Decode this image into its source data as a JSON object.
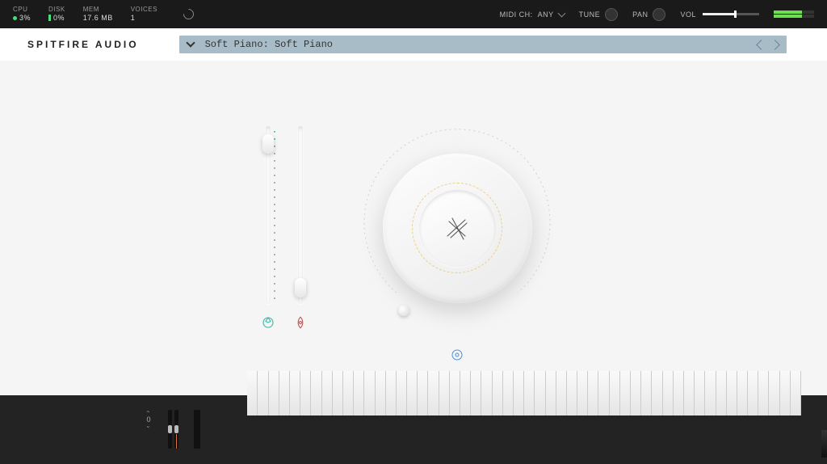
{
  "top": {
    "cpu_label": "CPU",
    "cpu_value": "3%",
    "disk_label": "DISK",
    "disk_value": "0%",
    "mem_label": "MEM",
    "mem_value": "17.6 MB",
    "voices_label": "VOICES",
    "voices_value": "1",
    "midi_label": "MIDI CH:",
    "midi_value": "ANY",
    "tune_label": "TUNE",
    "pan_label": "PAN",
    "vol_label": "VOL"
  },
  "brand": "SPITFIRE AUDIO",
  "preset": {
    "name": "Soft Piano: Soft Piano"
  },
  "sliders": {
    "expression": {
      "percent": 5,
      "icon": "expression-icon",
      "color": "#3fb8a8"
    },
    "dynamics": {
      "percent": 96,
      "icon": "dynamics-icon",
      "color": "#c05656"
    }
  },
  "dial": {
    "min_deg": 220,
    "max_deg": 500,
    "value_deg": 232,
    "icon": "reverb-icon",
    "icon_color": "#4a90d9"
  },
  "keyboard": {
    "octave_value": "0",
    "white_keys": 52
  }
}
